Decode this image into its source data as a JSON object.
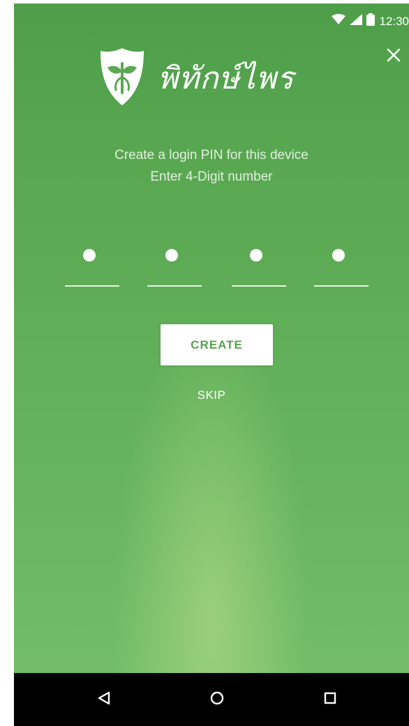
{
  "status_bar": {
    "time": "12:30",
    "icons": [
      "wifi-icon",
      "signal-icon",
      "battery-icon"
    ]
  },
  "header": {
    "app_name": "พิทักษ์ไพร",
    "logo_icon": "shield-leaf-icon",
    "close_icon": "close-icon"
  },
  "main": {
    "instruction_line1": "Create a login PIN for  this device",
    "instruction_line2": "Enter 4-Digit number",
    "pin": {
      "length": 4,
      "filled": 4
    },
    "create_label": "CREATE",
    "skip_label": "SKIP"
  },
  "nav_bar": {
    "buttons": [
      "back-icon",
      "home-icon",
      "recents-icon"
    ]
  },
  "colors": {
    "background_green": "#5aa852",
    "button_text": "#53a34e",
    "white": "#ffffff",
    "nav_bar": "#000000"
  }
}
